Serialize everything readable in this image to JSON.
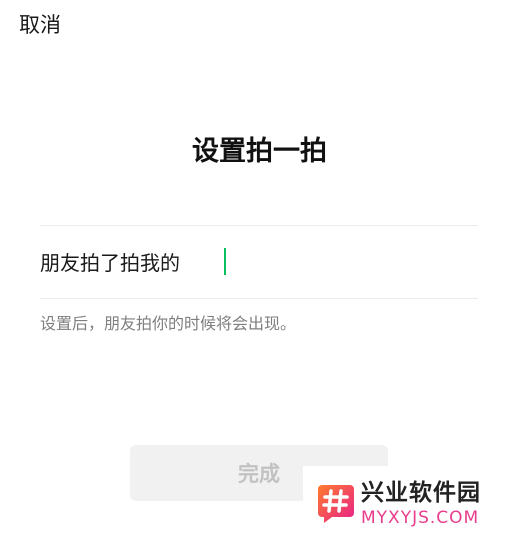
{
  "header": {
    "cancel_label": "取消"
  },
  "title": "设置拍一拍",
  "form": {
    "prefix": "朋友拍了拍我的",
    "value": "",
    "hint": "设置后，朋友拍你的时候将会出现。"
  },
  "actions": {
    "done_label": "完成"
  },
  "watermark": {
    "name": "兴业软件园",
    "url": "MYXYJS.COM"
  },
  "colors": {
    "accent": "#07c160",
    "button_bg": "#f1f1f1",
    "button_text_disabled": "#c2c2c2",
    "hint_text": "#7f7f7f",
    "watermark_pink": "#e83c8c"
  }
}
